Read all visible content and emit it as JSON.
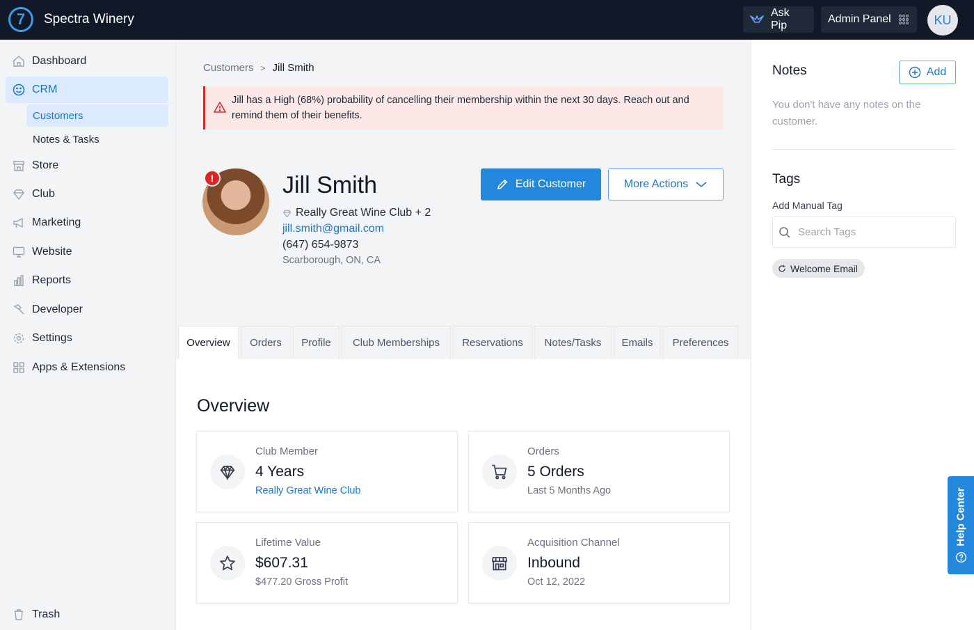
{
  "app": {
    "logo": "7",
    "title": "Spectra Winery"
  },
  "topbar": {
    "ask_pip": "Ask Pip",
    "admin_panel": "Admin Panel",
    "avatar_initials": "KU"
  },
  "sidebar": {
    "items": [
      {
        "label": "Dashboard",
        "icon": "home-icon"
      },
      {
        "label": "CRM",
        "icon": "smile-icon"
      },
      {
        "label": "Store",
        "icon": "store-icon"
      },
      {
        "label": "Club",
        "icon": "diamond-icon"
      },
      {
        "label": "Marketing",
        "icon": "megaphone-icon"
      },
      {
        "label": "Website",
        "icon": "monitor-icon"
      },
      {
        "label": "Reports",
        "icon": "chart-icon"
      },
      {
        "label": "Developer",
        "icon": "hammer-icon"
      },
      {
        "label": "Settings",
        "icon": "gear-icon"
      },
      {
        "label": "Apps & Extensions",
        "icon": "apps-icon"
      }
    ],
    "sub_items": [
      "Customers",
      "Notes & Tasks"
    ],
    "trash": "Trash"
  },
  "breadcrumb": {
    "parent": "Customers",
    "separator": ">",
    "current": "Jill Smith"
  },
  "alert": {
    "text": "Jill has a High (68%) probability of cancelling their membership within the next 30 days. Reach out and remind them of their benefits."
  },
  "customer": {
    "flag": "!",
    "name": "Jill Smith",
    "club": "Really Great Wine Club + 2",
    "email": "jill.smith@gmail.com",
    "phone": "(647) 654-9873",
    "location": "Scarborough, ON, CA"
  },
  "actions": {
    "edit": "Edit Customer",
    "more": "More Actions"
  },
  "tabs": [
    "Overview",
    "Orders",
    "Profile",
    "Club Memberships",
    "Reservations",
    "Notes/Tasks",
    "Emails",
    "Preferences"
  ],
  "overview": {
    "title": "Overview",
    "cards": [
      {
        "label": "Club Member",
        "value": "4 Years",
        "sub": "Really Great Wine Club",
        "icon": "diamond-icon"
      },
      {
        "label": "Orders",
        "value": "5 Orders",
        "sub": "Last 5 Months Ago",
        "icon": "cart-icon"
      },
      {
        "label": "Lifetime Value",
        "value": "$607.31",
        "sub": "$477.20 Gross Profit",
        "icon": "star-icon"
      },
      {
        "label": "Acquisition Channel",
        "value": "Inbound",
        "sub": "Oct 12, 2022",
        "icon": "storefront-icon"
      }
    ]
  },
  "notes": {
    "title": "Notes",
    "add": "Add",
    "empty": "You don't have any notes on the customer."
  },
  "tags": {
    "title": "Tags",
    "manual_label": "Add Manual Tag",
    "search_placeholder": "Search Tags",
    "chips": [
      "Welcome Email"
    ]
  },
  "help": {
    "label": "Help Center"
  },
  "colors": {
    "accent": "#2388dc",
    "topbar": "#111827",
    "alert_bg": "#fde8e8",
    "alert_border": "#dc2626"
  }
}
